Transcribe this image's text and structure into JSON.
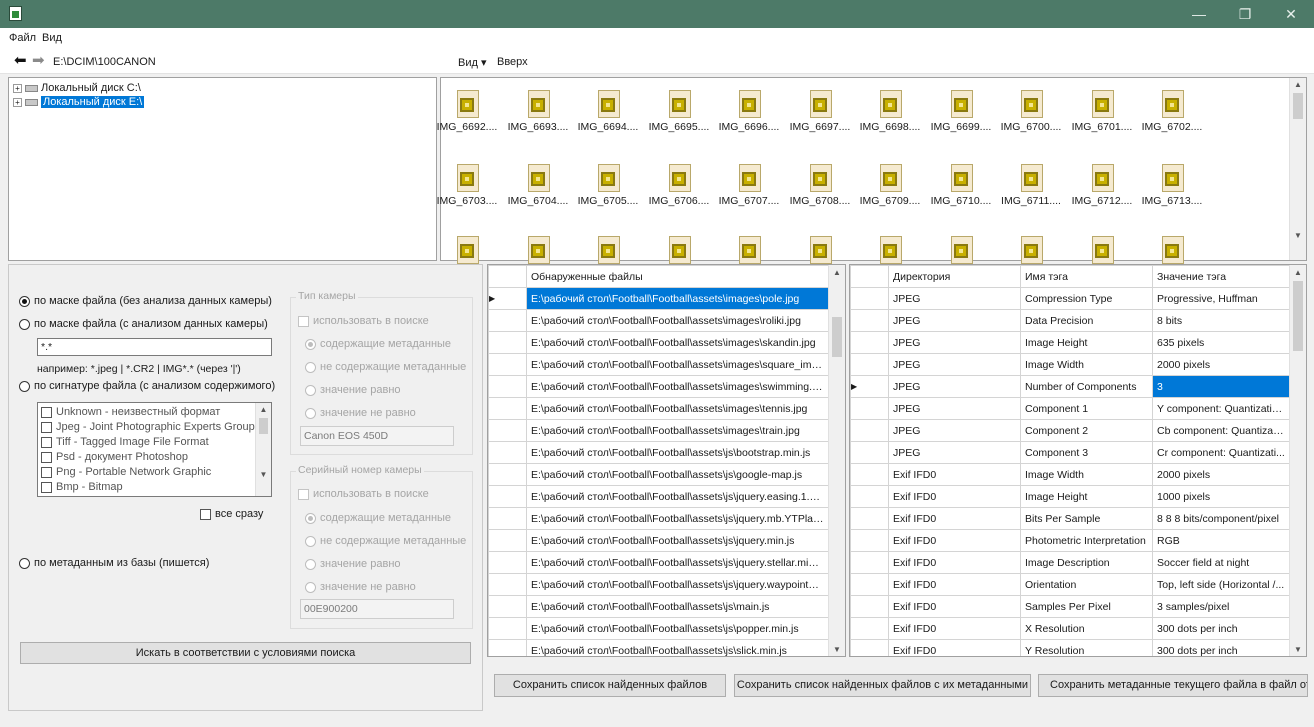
{
  "window": {
    "minimize_glyph": "—",
    "restore_glyph": "❐",
    "close_glyph": "✕"
  },
  "menu": {
    "file": "Файл",
    "view": "Вид"
  },
  "nav": {
    "back_glyph": "⬅",
    "forward_glyph": "➡",
    "path": "E:\\DCIM\\100CANON"
  },
  "toolbar": {
    "view_label": "Вид ▾",
    "up_label": "Вверх"
  },
  "tree": {
    "items": [
      {
        "label": "Локальный диск C:\\",
        "expander": "+",
        "selected": false
      },
      {
        "label": "Локальный диск E:\\",
        "expander": "+",
        "selected": true
      }
    ]
  },
  "files": [
    "IMG_6692....",
    "IMG_6693....",
    "IMG_6694....",
    "IMG_6695....",
    "IMG_6696....",
    "IMG_6697....",
    "IMG_6698....",
    "IMG_6699....",
    "IMG_6700....",
    "IMG_6701....",
    "IMG_6702....",
    "IMG_6703....",
    "IMG_6704....",
    "IMG_6705....",
    "IMG_6706....",
    "IMG_6707....",
    "IMG_6708....",
    "IMG_6709....",
    "IMG_6710....",
    "IMG_6711....",
    "IMG_6712....",
    "IMG_6713....",
    "",
    "",
    "",
    "",
    "",
    "",
    "",
    "",
    "",
    "",
    ""
  ],
  "search": {
    "radio_mask_no_camera": "по маске файла (без анализа данных камеры)",
    "radio_mask_camera": "по маске файла (с анализом данных камеры)",
    "mask_value": "*.*",
    "mask_hint": "например: *.jpeg | *.CR2 | IMG*.* (через '|')",
    "radio_signature": "по сигнатуре файла (с анализом содержимого)",
    "formats": [
      "Unknown - неизвестный формат",
      "Jpeg - Joint Photographic Experts Group",
      "Tiff - Tagged Image File Format",
      "Psd - документ Photoshop",
      "Png - Portable Network Graphic",
      "Bmp - Bitmap"
    ],
    "all_at_once": "все сразу",
    "radio_metadata_db": "по метаданным из базы (пишется)",
    "camera_type": {
      "title": "Тип камеры",
      "use_in_search": "использовать в поиске",
      "contains": "содержащие метаданные",
      "not_contains": "не содержащие метаданные",
      "equals": "значение равно",
      "not_equals": "значение не равно",
      "value": "Canon EOS 450D"
    },
    "serial": {
      "title": "Серийный номер камеры",
      "use_in_search": "использовать в поиске",
      "contains": "содержащие метаданные",
      "not_contains": "не содержащие метаданные",
      "equals": "значение равно",
      "not_equals": "значение не равно",
      "value": "00E900200"
    },
    "search_button": "Искать в соответствии с условиями поиска"
  },
  "found": {
    "header": "Обнаруженные файлы",
    "rows": [
      "E:\\рабочий стол\\Football\\Football\\assets\\images\\pole.jpg",
      "E:\\рабочий стол\\Football\\Football\\assets\\images\\roliki.jpg",
      "E:\\рабочий стол\\Football\\Football\\assets\\images\\skandin.jpg",
      "E:\\рабочий стол\\Football\\Football\\assets\\images\\square_img...",
      "E:\\рабочий стол\\Football\\Football\\assets\\images\\swimming.jpg",
      "E:\\рабочий стол\\Football\\Football\\assets\\images\\tennis.jpg",
      "E:\\рабочий стол\\Football\\Football\\assets\\images\\train.jpg",
      "E:\\рабочий стол\\Football\\Football\\assets\\js\\bootstrap.min.js",
      "E:\\рабочий стол\\Football\\Football\\assets\\js\\google-map.js",
      "E:\\рабочий стол\\Football\\Football\\assets\\js\\jquery.easing.1.3.js",
      "E:\\рабочий стол\\Football\\Football\\assets\\js\\jquery.mb.YTPlay...",
      "E:\\рабочий стол\\Football\\Football\\assets\\js\\jquery.min.js",
      "E:\\рабочий стол\\Football\\Football\\assets\\js\\jquery.stellar.min.js",
      "E:\\рабочий стол\\Football\\Football\\assets\\js\\jquery.waypoints....",
      "E:\\рабочий стол\\Football\\Football\\assets\\js\\main.js",
      "E:\\рабочий стол\\Football\\Football\\assets\\js\\popper.min.js",
      "E:\\рабочий стол\\Football\\Football\\assets\\js\\slick.min.js"
    ],
    "current_row_marker": "▶"
  },
  "meta": {
    "headers": [
      "Директория",
      "Имя тэга",
      "Значение тэга"
    ],
    "rows": [
      [
        "JPEG",
        "Compression Type",
        "Progressive, Huffman"
      ],
      [
        "JPEG",
        "Data Precision",
        "8 bits"
      ],
      [
        "JPEG",
        "Image Height",
        "635 pixels"
      ],
      [
        "JPEG",
        "Image Width",
        "2000 pixels"
      ],
      [
        "JPEG",
        "Number of Components",
        "3"
      ],
      [
        "JPEG",
        "Component 1",
        "Y component: Quantizatio..."
      ],
      [
        "JPEG",
        "Component 2",
        "Cb component: Quantizati..."
      ],
      [
        "JPEG",
        "Component 3",
        "Cr component: Quantizati..."
      ],
      [
        "Exif IFD0",
        "Image Width",
        "2000 pixels"
      ],
      [
        "Exif IFD0",
        "Image Height",
        "1000 pixels"
      ],
      [
        "Exif IFD0",
        "Bits Per Sample",
        "8 8 8 bits/component/pixel"
      ],
      [
        "Exif IFD0",
        "Photometric Interpretation",
        "RGB"
      ],
      [
        "Exif IFD0",
        "Image Description",
        "Soccer field at night"
      ],
      [
        "Exif IFD0",
        "Orientation",
        "Top, left side (Horizontal /..."
      ],
      [
        "Exif IFD0",
        "Samples Per Pixel",
        "3 samples/pixel"
      ],
      [
        "Exif IFD0",
        "X Resolution",
        "300 dots per inch"
      ],
      [
        "Exif IFD0",
        "Y Resolution",
        "300 dots per inch"
      ]
    ],
    "current_row_marker": "▶"
  },
  "bottom_buttons": {
    "save_found": "Сохранить список найденных файлов",
    "save_found_meta": "Сохранить список найденных файлов с их метаданными",
    "save_current_meta": "Сохранить метаданные текущего файла в файл отчё"
  }
}
